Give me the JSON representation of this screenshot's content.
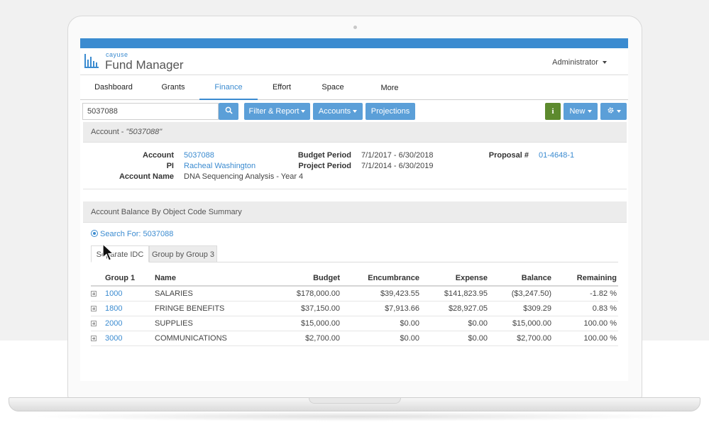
{
  "brand": {
    "small": "cayuse",
    "main": "Fund Manager"
  },
  "user_menu": {
    "label": "Administrator"
  },
  "nav": [
    {
      "label": "Dashboard"
    },
    {
      "label": "Grants"
    },
    {
      "label": "Finance",
      "active": true
    },
    {
      "label": "Effort"
    },
    {
      "label": "Space"
    },
    {
      "label": "More"
    }
  ],
  "toolbar": {
    "search_value": "5037088",
    "filter_report": "Filter & Report",
    "accounts": "Accounts",
    "projections": "Projections",
    "info": "i",
    "new": "New"
  },
  "account_panel": {
    "title_prefix": "Account - ",
    "title_value": "\"5037088\"",
    "fields": {
      "account_label": "Account",
      "account_value": "5037088",
      "pi_label": "PI",
      "pi_value": "Racheal Washington",
      "name_label": "Account Name",
      "name_value": "DNA Sequencing Analysis - Year 4",
      "budget_period_label": "Budget Period",
      "budget_period_value": "7/1/2017 - 6/30/2018",
      "project_period_label": "Project Period",
      "project_period_value": "7/1/2014 - 6/30/2019",
      "proposal_label": "Proposal #",
      "proposal_value": "01-4648-1"
    }
  },
  "summary_panel": {
    "title": "Account Balance By Object Code Summary",
    "search_for": "Search For: 5037088",
    "tabs": [
      {
        "label": "Separate IDC",
        "active": true
      },
      {
        "label": "Group by Group 3"
      }
    ],
    "columns": [
      "Group 1",
      "Name",
      "Budget",
      "Encumbrance",
      "Expense",
      "Balance",
      "Remaining"
    ],
    "rows": [
      {
        "code": "1000",
        "name": "SALARIES",
        "budget": "$178,000.00",
        "encumbrance": "$39,423.55",
        "expense": "$141,823.95",
        "balance": "($3,247.50)",
        "remaining": "-1.82 %"
      },
      {
        "code": "1800",
        "name": "FRINGE BENEFITS",
        "budget": "$37,150.00",
        "encumbrance": "$7,913.66",
        "expense": "$28,927.05",
        "balance": "$309.29",
        "remaining": "0.83 %"
      },
      {
        "code": "2000",
        "name": "SUPPLIES",
        "budget": "$15,000.00",
        "encumbrance": "$0.00",
        "expense": "$0.00",
        "balance": "$15,000.00",
        "remaining": "100.00 %"
      },
      {
        "code": "3000",
        "name": "COMMUNICATIONS",
        "budget": "$2,700.00",
        "encumbrance": "$0.00",
        "expense": "$0.00",
        "balance": "$2,700.00",
        "remaining": "100.00 %"
      }
    ]
  },
  "colors": {
    "accent": "#3b8bd0",
    "button": "#5b9fd8",
    "info_button": "#5d8a2e",
    "negative": "#b06a7a"
  }
}
